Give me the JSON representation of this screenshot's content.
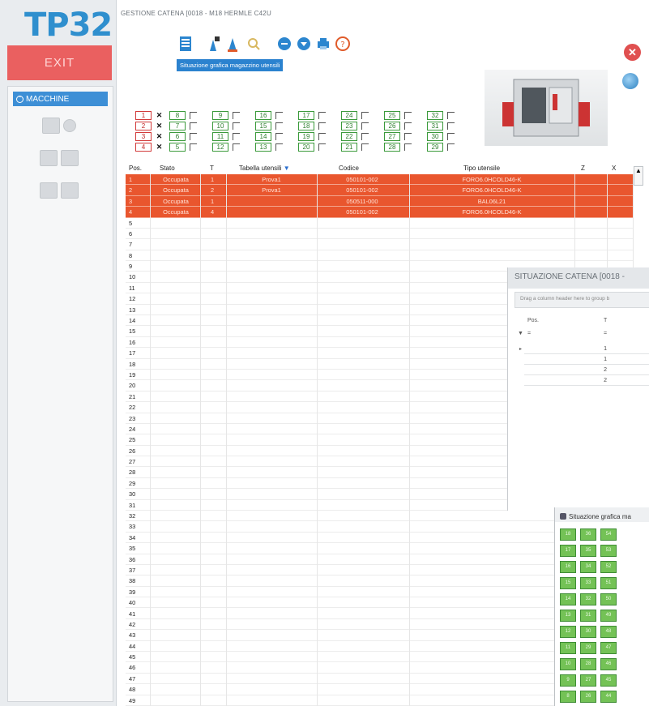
{
  "sidebar": {
    "logo": "TP32",
    "exit_label": "EXIT",
    "machine_label": "MACCHINE",
    "icons": [
      "machine-tools-icon",
      "magazine-icon",
      "tool-list-icon"
    ]
  },
  "window": {
    "title": "GESTIONE CATENA [0018 - M18 HERMLE C42U"
  },
  "toolbar": {
    "tooltip": "Situazione grafica magazzino utensili",
    "buttons": [
      "magazine-view-icon",
      "tool-lock-icon",
      "tool-icon",
      "search-icon",
      "prev-icon",
      "next-icon",
      "print-icon",
      "help-icon"
    ]
  },
  "slots": {
    "left_column": [
      {
        "label": "1",
        "checked": true
      },
      {
        "label": "2",
        "checked": true
      },
      {
        "label": "3",
        "checked": true
      },
      {
        "label": "4",
        "checked": true
      }
    ],
    "columns": [
      [
        "8",
        "7",
        "6",
        "5"
      ],
      [
        "9",
        "10",
        "11",
        "12"
      ],
      [
        "16",
        "15",
        "14",
        "13"
      ],
      [
        "17",
        "18",
        "19",
        "20"
      ],
      [
        "24",
        "23",
        "22",
        "21"
      ],
      [
        "25",
        "26",
        "27",
        "28"
      ],
      [
        "32",
        "31",
        "30",
        "29"
      ]
    ]
  },
  "table": {
    "headers": {
      "pos": "Pos.",
      "stato": "Stato",
      "t": "T",
      "tabella": "Tabella utensili",
      "codice": "Codice",
      "tipo": "Tipo utensile",
      "z": "Z",
      "x": "X"
    },
    "rows": [
      {
        "pos": "1",
        "stato": "Occupata",
        "t": "1",
        "tabella": "Prova1",
        "codice": "050101-002",
        "tipo": "FORO6.0HCOLD46-K"
      },
      {
        "pos": "2",
        "stato": "Occupata",
        "t": "2",
        "tabella": "Prova1",
        "codice": "050101-002",
        "tipo": "FORO6.0HCOLD46-K"
      },
      {
        "pos": "3",
        "stato": "Occupata",
        "t": "1",
        "tabella": "",
        "codice": "050511-000",
        "tipo": "BAL06L21"
      },
      {
        "pos": "4",
        "stato": "Occupata",
        "t": "4",
        "tabella": "",
        "codice": "050101-002",
        "tipo": "FORO6.0HCOLD46-K"
      }
    ],
    "total_rows": 49
  },
  "catena_window": {
    "title": "SITUAZIONE CATENA [0018 -",
    "group_hint": "Drag a column header here to group b",
    "headers": {
      "pos": "Pos.",
      "t": "T"
    },
    "filter": "=",
    "t_values": [
      "1",
      "1",
      "2",
      "2"
    ]
  },
  "grafico_window": {
    "title": "Situazione grafica ma",
    "grid": [
      [
        "18",
        "36",
        "54"
      ],
      [
        "17",
        "35",
        "53"
      ],
      [
        "16",
        "34",
        "52"
      ],
      [
        "15",
        "33",
        "51"
      ],
      [
        "14",
        "32",
        "50"
      ],
      [
        "13",
        "31",
        "49"
      ],
      [
        "12",
        "30",
        "48"
      ],
      [
        "11",
        "29",
        "47"
      ],
      [
        "10",
        "28",
        "46"
      ],
      [
        "9",
        "27",
        "45"
      ],
      [
        "8",
        "26",
        "44"
      ]
    ]
  },
  "colors": {
    "accent": "#2f8fce",
    "exit": "#ea6060",
    "occupied": "#e9562e",
    "slot_green": "#74c256"
  }
}
